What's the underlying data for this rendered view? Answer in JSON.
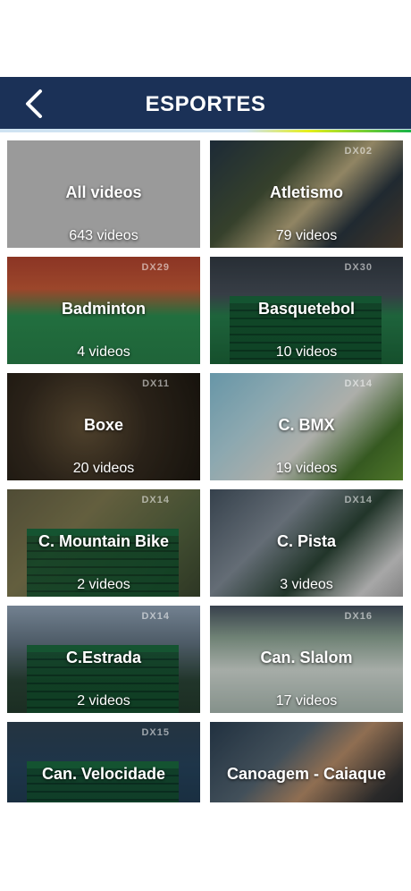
{
  "header": {
    "title": "ESPORTES",
    "colors": {
      "bar": "#1b3157",
      "stripe": "#cfe3f2"
    }
  },
  "tiles": [
    {
      "name": "All videos",
      "count": "643 videos",
      "dx": ""
    },
    {
      "name": "Atletismo",
      "count": "79 videos",
      "dx": "DX02"
    },
    {
      "name": "Badminton",
      "count": "4 videos",
      "dx": "DX29"
    },
    {
      "name": "Basquetebol",
      "count": "10 videos",
      "dx": "DX30"
    },
    {
      "name": "Boxe",
      "count": "20 videos",
      "dx": "DX11"
    },
    {
      "name": "C. BMX",
      "count": "19 videos",
      "dx": "DX14"
    },
    {
      "name": "C. Mountain Bike",
      "count": "2 videos",
      "dx": "DX14"
    },
    {
      "name": "C. Pista",
      "count": "3 videos",
      "dx": "DX14"
    },
    {
      "name": "C.Estrada",
      "count": "2 videos",
      "dx": "DX14"
    },
    {
      "name": "Can. Slalom",
      "count": "17 videos",
      "dx": "DX16"
    },
    {
      "name": "Can. Velocidade",
      "count": "",
      "dx": "DX15"
    },
    {
      "name": "Canoagem - Caiaque",
      "count": "",
      "dx": ""
    }
  ]
}
